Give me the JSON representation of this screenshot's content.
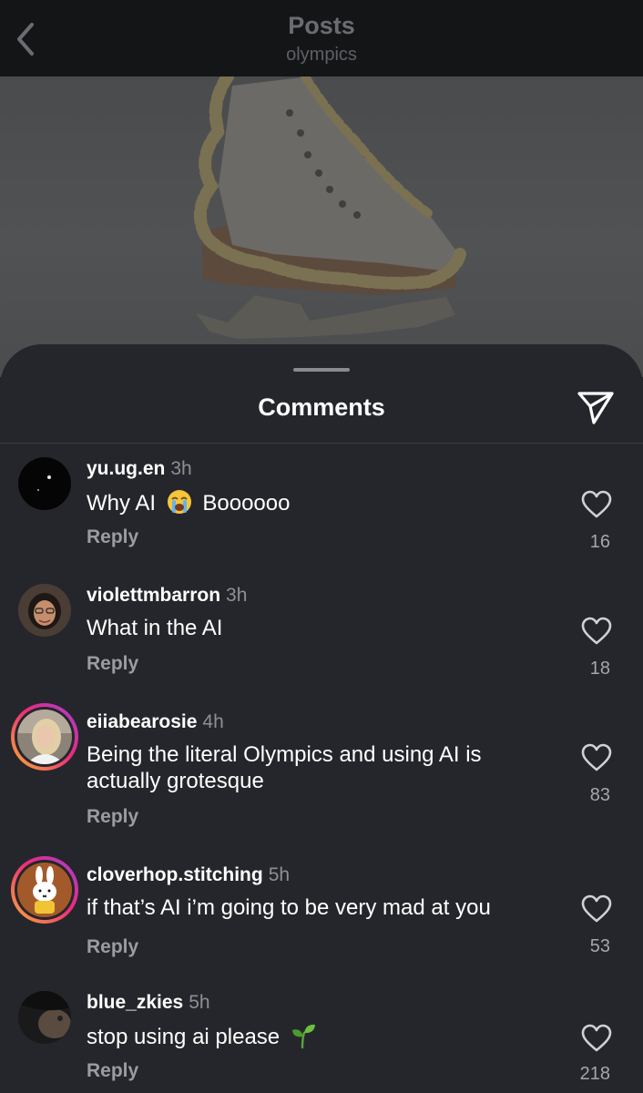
{
  "header": {
    "title": "Posts",
    "subtitle": "olympics"
  },
  "sheet": {
    "title": "Comments"
  },
  "comments": [
    {
      "username": "yu.ug.en",
      "time": "3h",
      "text_before": "Why AI",
      "emoji": "loudly-crying-face",
      "text_after": "Boooooo",
      "reply": "Reply",
      "likes": "16"
    },
    {
      "username": "violettmbarron",
      "time": "3h",
      "text": "What in the AI",
      "reply": "Reply",
      "likes": "18"
    },
    {
      "username": "eiiabearosie",
      "time": "4h",
      "text": "Being the literal Olympics and using AI is actually grotesque",
      "reply": "Reply",
      "likes": "83"
    },
    {
      "username": "cloverhop.stitching",
      "time": "5h",
      "text": "if that’s AI i’m going to be very mad at you",
      "reply": "Reply",
      "likes": "53"
    },
    {
      "username": "blue_zkies",
      "time": "5h",
      "text": "stop using ai please",
      "emoji": "seedling",
      "reply": "Reply",
      "likes": "218"
    }
  ],
  "icons": {
    "back": "chevron-left-icon",
    "share": "paper-plane-icon",
    "like": "heart-outline-icon"
  },
  "colors": {
    "sheet_background": "#25262b",
    "header_background": "#141517",
    "story_ring_start": "#f9b233",
    "story_ring_end": "#a23fd6"
  }
}
